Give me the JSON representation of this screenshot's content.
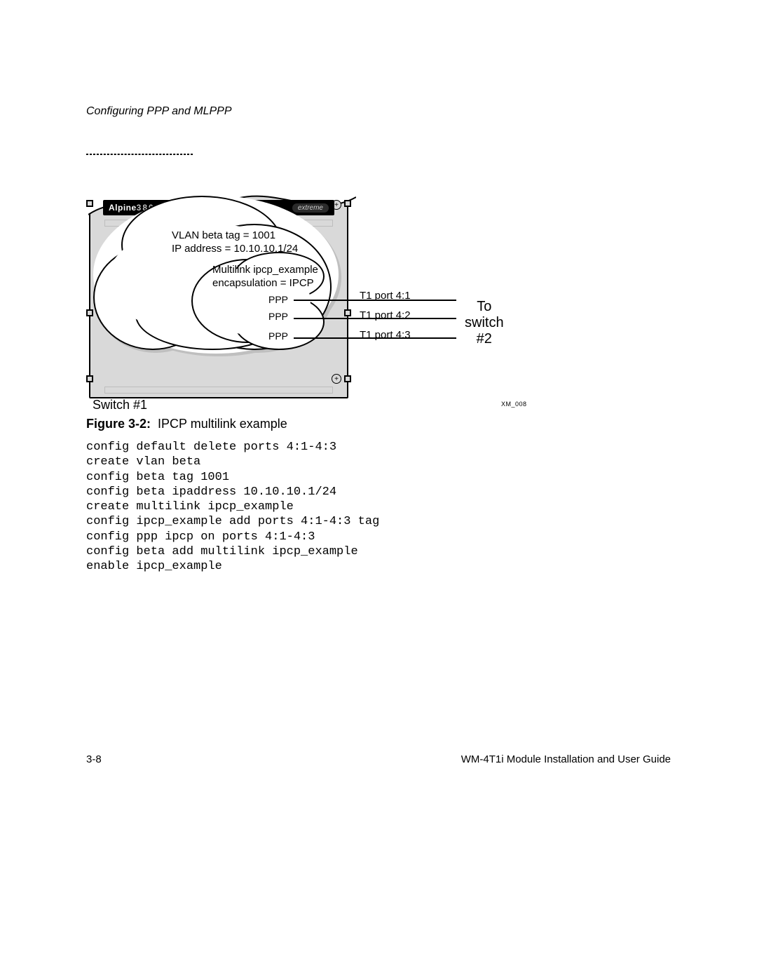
{
  "header": {
    "running_head": "Configuring PPP and MLPPP"
  },
  "diagram": {
    "device_brand": "Alpine",
    "device_model_outline": "3800",
    "device_right_badge": "extreme",
    "vlan_label_line1": "VLAN beta   tag = 1001",
    "vlan_label_line2": "IP address = 10.10.10.1/24",
    "multilink_line1": "Multilink ipcp_example",
    "multilink_line2": "encapsulation = IPCP",
    "ppp_labels": [
      "PPP",
      "PPP",
      "PPP"
    ],
    "port_labels": [
      "T1 port 4:1",
      "T1 port 4:2",
      "T1 port 4:3"
    ],
    "to_switch_line1": "To",
    "to_switch_line2": "switch",
    "to_switch_line3": "#2",
    "switch_name": "Switch  #1",
    "figure_code": "XM_008"
  },
  "caption": {
    "label": "Figure 3-2:",
    "text": "IPCP multilink example"
  },
  "config_block": "config default delete ports 4:1-4:3\ncreate vlan beta\nconfig beta tag 1001\nconfig beta ipaddress 10.10.10.1/24\ncreate multilink ipcp_example\nconfig ipcp_example add ports 4:1-4:3 tag\nconfig ppp ipcp on ports 4:1-4:3\nconfig beta add multilink ipcp_example\nenable ipcp_example",
  "footer": {
    "page_number": "3-8",
    "doc_title": "WM-4T1i Module Installation and User Guide"
  }
}
